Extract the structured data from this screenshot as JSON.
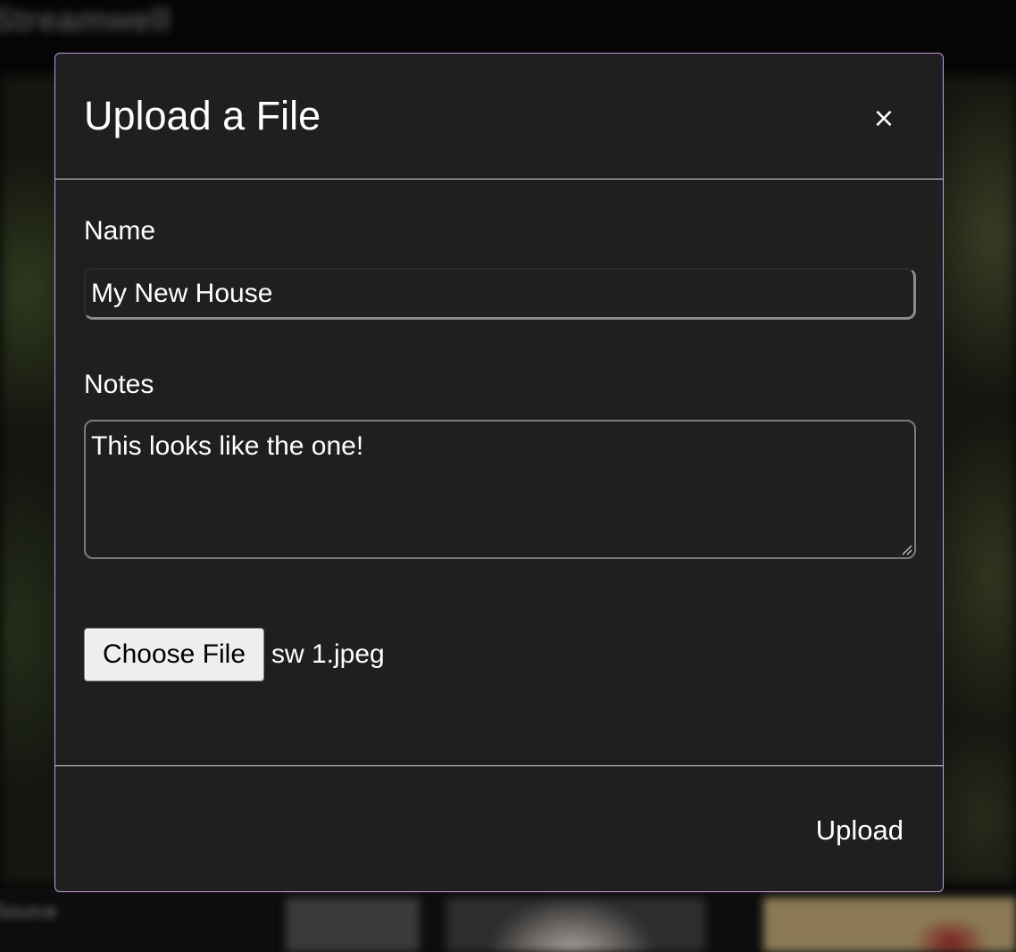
{
  "background": {
    "app_title": "Streamwell",
    "bottom_label": "Source"
  },
  "modal": {
    "title": "Upload a File",
    "close_label": "×",
    "name_label": "Name",
    "name_value": "My New House",
    "notes_label": "Notes",
    "notes_value": "This looks like the one!",
    "choose_file_label": "Choose File",
    "selected_file": "sw 1.jpeg",
    "upload_label": "Upload"
  },
  "colors": {
    "modal_background": "#1f1f1f",
    "modal_border": "#c79bdf",
    "text": "#ffffff"
  },
  "icons": {
    "close": "close-icon",
    "resize": "resize-grip-icon"
  }
}
